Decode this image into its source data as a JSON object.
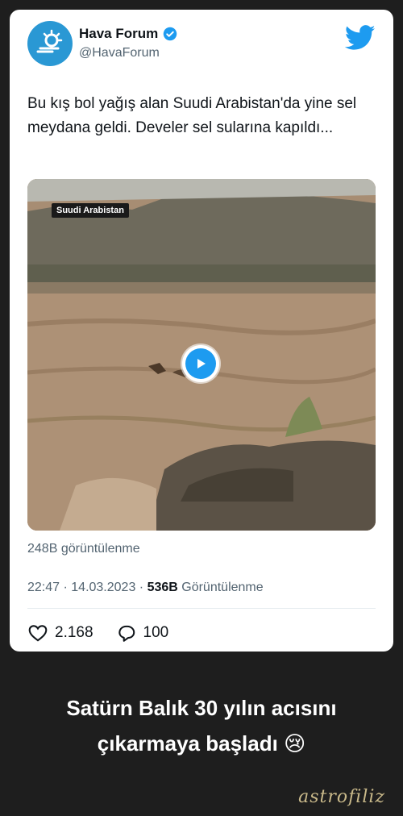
{
  "tweet": {
    "author_name": "Hava Forum",
    "author_handle": "@HavaForum",
    "text": "Bu kış bol yağış alan Suudi Arabistan'da yine sel meydana geldi. Develer sel sularına kapıldı...",
    "video_label": "Suudi Arabistan",
    "views_short": "248B görüntülenme",
    "time": "22:47",
    "separator": " · ",
    "date": "14.03.2023",
    "views_count": "536B",
    "views_word": " Görüntülenme",
    "likes": "2.168",
    "replies": "100",
    "icons": [
      "twitter-bird-icon",
      "verified-badge-icon",
      "play-icon",
      "heart-icon",
      "reply-icon"
    ],
    "colors": {
      "accent": "#1d9bf0",
      "avatar": "#2a98d4"
    }
  },
  "caption": {
    "line1": "Satürn Balık 30 yılın acısını",
    "line2": "çıkarmaya başladı",
    "emoji": "😢"
  },
  "signature": "astrofiliz"
}
